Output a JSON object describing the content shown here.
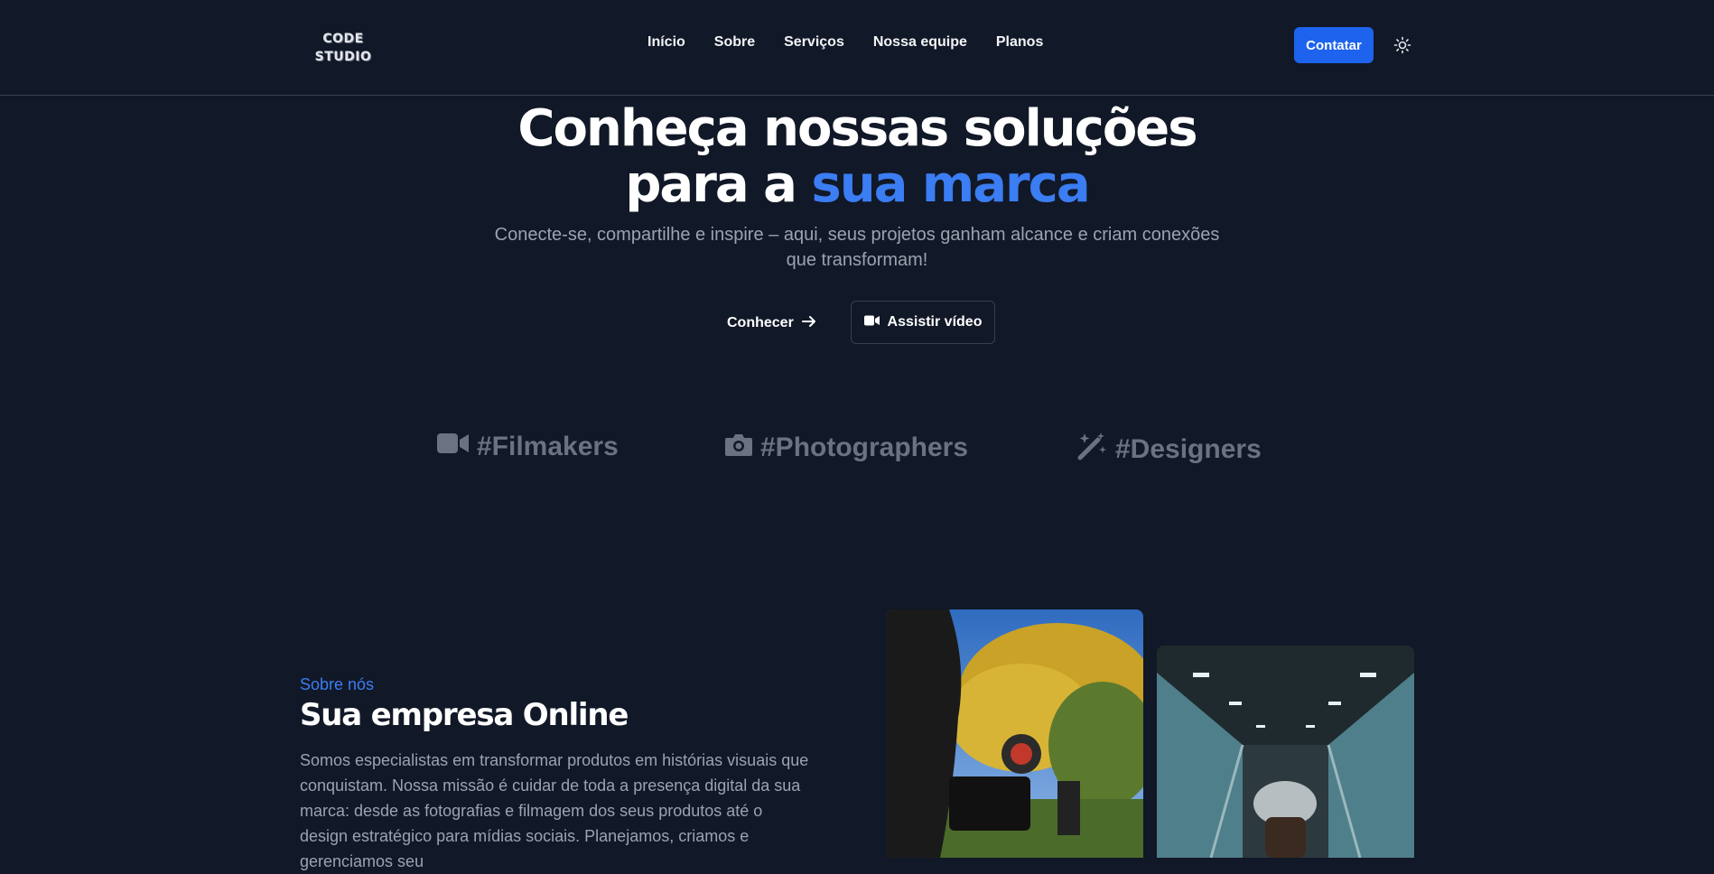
{
  "header": {
    "logo_line1": "CODE",
    "logo_line2": "STUDIO",
    "nav": [
      "Início",
      "Sobre",
      "Serviços",
      "Nossa equipe",
      "Planos"
    ],
    "contact_label": "Contatar"
  },
  "hero": {
    "title_line1": "Conheça nossas soluções",
    "title_line2_prefix": "para a ",
    "title_line2_accent": "sua marca",
    "subtitle": "Conecte-se, compartilhe e inspire – aqui, seus projetos ganham alcance e criam conexões que transformam!",
    "primary_cta": "Conhecer",
    "secondary_cta": "Assistir vídeo"
  },
  "tags": [
    {
      "label": "#Filmakers",
      "icon": "video-icon"
    },
    {
      "label": "#Photographers",
      "icon": "camera-icon"
    },
    {
      "label": "#Designers",
      "icon": "magic-wand-icon"
    }
  ],
  "about": {
    "label": "Sobre nós",
    "title": "Sua empresa Online",
    "text": "Somos especialistas em transformar produtos em histórias visuais que conquistam. Nossa missão é cuidar de toda a presença digital da sua marca: desde as fotografias e filmagem dos seus produtos até o design estratégico para mídias sociais. Planejamos, criamos e gerenciamos seu"
  },
  "colors": {
    "background": "#111827",
    "accent": "#3b7df2",
    "button": "#1d63ed",
    "muted_text": "#9ca3af",
    "tag_text": "#6b7280"
  }
}
